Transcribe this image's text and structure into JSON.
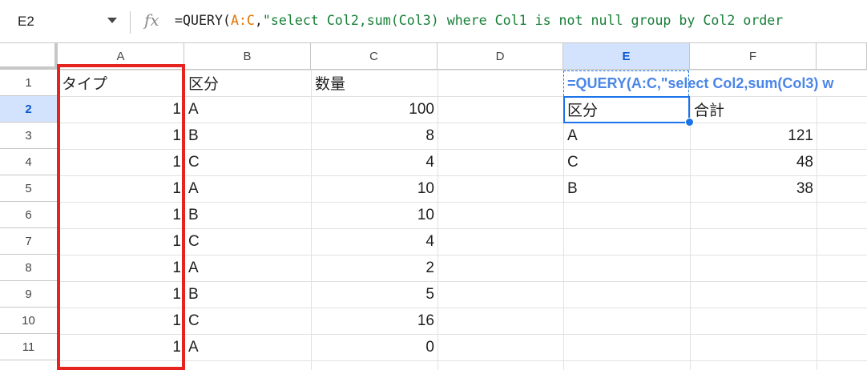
{
  "formula_bar": {
    "name_box": "E2",
    "fx_label": "fx",
    "formula_prefix": "=QUERY(",
    "formula_range": "A:C",
    "formula_comma": ",",
    "formula_string": "\"select Col2,sum(Col3) where Col1 is not null group by Col2 order"
  },
  "columns": [
    {
      "label": "A"
    },
    {
      "label": "B"
    },
    {
      "label": "C"
    },
    {
      "label": "D"
    },
    {
      "label": "E"
    },
    {
      "label": "F"
    }
  ],
  "rows": [
    "1",
    "2",
    "3",
    "4",
    "5",
    "6",
    "7",
    "8",
    "9",
    "10",
    "11"
  ],
  "cells": {
    "a": [
      "タイプ",
      "1",
      "1",
      "1",
      "1",
      "1",
      "1",
      "1",
      "1",
      "1",
      "1"
    ],
    "b": [
      "区分",
      "A",
      "B",
      "C",
      "A",
      "B",
      "C",
      "A",
      "B",
      "C",
      "A"
    ],
    "c": [
      "数量",
      "100",
      "8",
      "4",
      "10",
      "10",
      "4",
      "2",
      "5",
      "16",
      "0"
    ],
    "e1": "=QUERY(A:C,\"select Col2,sum(Col3) w",
    "e": [
      "区分",
      "A",
      "C",
      "B"
    ],
    "f": [
      "合計",
      "121",
      "48",
      "38"
    ]
  },
  "colors": {
    "selection": "#1a73e8",
    "highlight_box": "#e52420",
    "header_selected_bg": "#d3e3fd"
  }
}
